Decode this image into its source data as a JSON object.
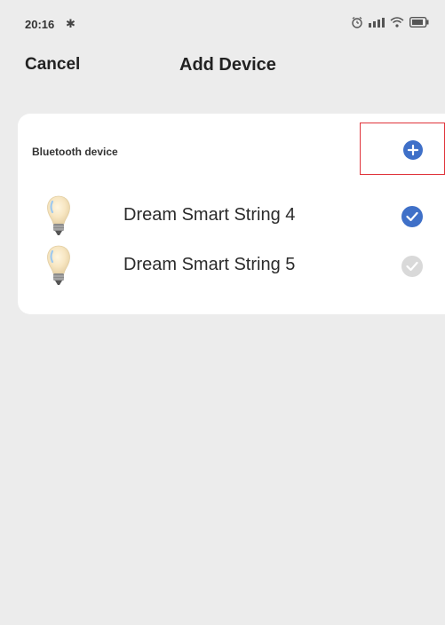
{
  "status_bar": {
    "time": "20:16",
    "bluetooth_glyph": "✱",
    "icons": [
      "alarm-icon",
      "signal-icon",
      "wifi-icon",
      "battery-icon"
    ]
  },
  "header": {
    "cancel_label": "Cancel",
    "title": "Add Device"
  },
  "bluetooth_section": {
    "label": "Bluetooth device",
    "add_icon": "plus-circle-icon",
    "highlight_color": "#e0333a",
    "devices": [
      {
        "name": "Dream Smart String 4",
        "icon": "light-bulb-icon",
        "selected": true
      },
      {
        "name": "Dream Smart String 5",
        "icon": "light-bulb-icon",
        "selected": false
      }
    ]
  },
  "colors": {
    "accent": "#3f70c8",
    "background": "#ececec",
    "card": "#ffffff",
    "unselected": "#d9d9d9"
  }
}
